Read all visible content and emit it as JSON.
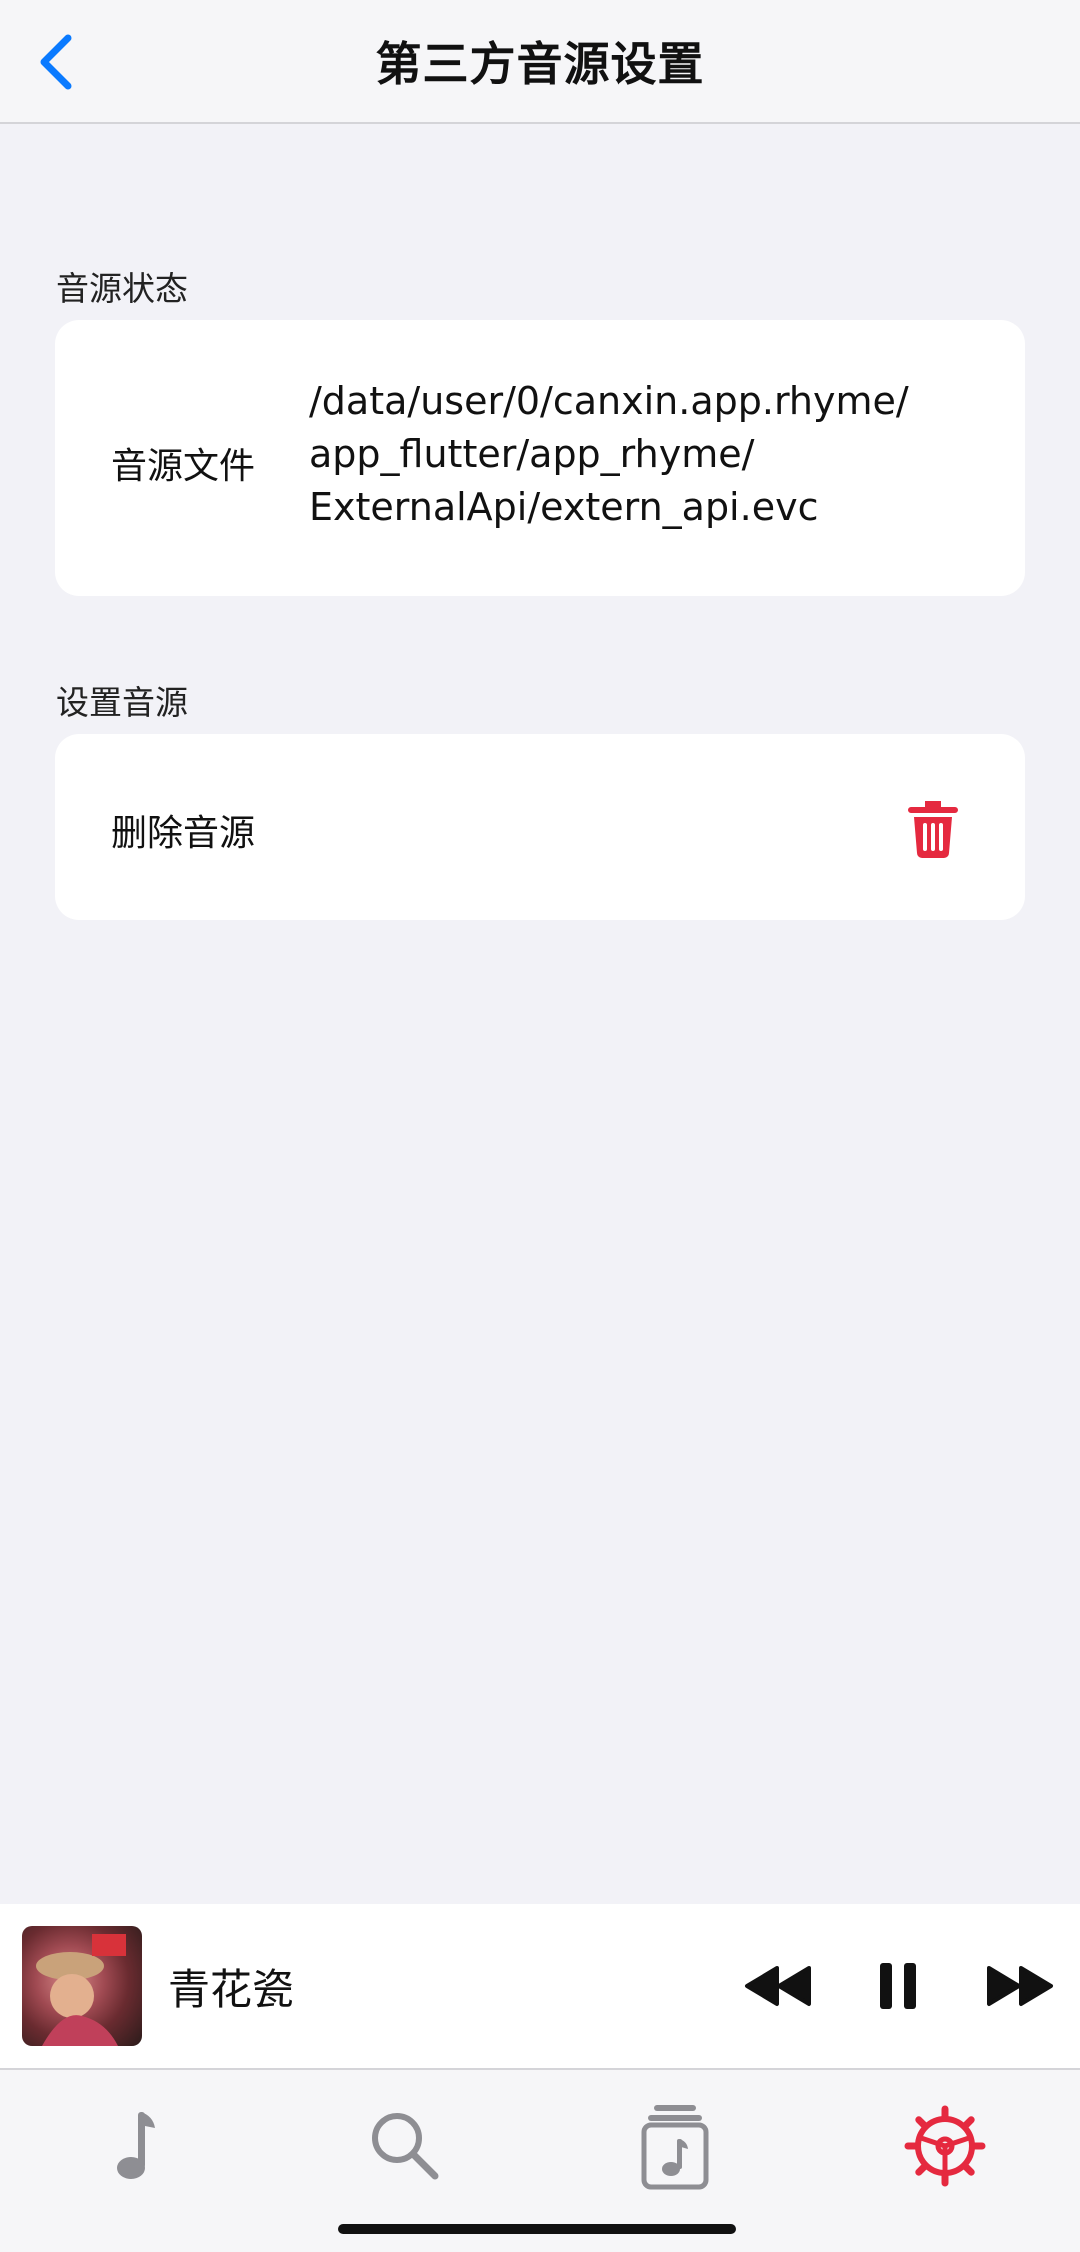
{
  "nav": {
    "title": "第三方音源设置",
    "back_icon": "chevron-left-icon"
  },
  "sections": {
    "status": {
      "title": "音源状态",
      "file_label": "音源文件",
      "file_path_lines": [
        "/data/user/0/canxin.app.rhyme/",
        "app_flutter/app_rhyme/",
        "ExternalApi/extern_api.evc"
      ]
    },
    "settings": {
      "title": "设置音源",
      "delete_label": "删除音源",
      "delete_icon": "trash-icon"
    }
  },
  "player": {
    "song_title": "青花瓷",
    "controls": [
      "rewind-icon",
      "pause-icon",
      "fast-forward-icon"
    ]
  },
  "tabs": [
    {
      "icon": "music-note-icon",
      "active": false
    },
    {
      "icon": "search-icon",
      "active": false
    },
    {
      "icon": "playlist-icon",
      "active": false
    },
    {
      "icon": "settings-icon",
      "active": true
    }
  ],
  "colors": {
    "accent_blue": "#0a7aff",
    "accent_red": "#e5293f",
    "inactive_gray": "#8e8e93",
    "background": "#f2f2f7"
  }
}
